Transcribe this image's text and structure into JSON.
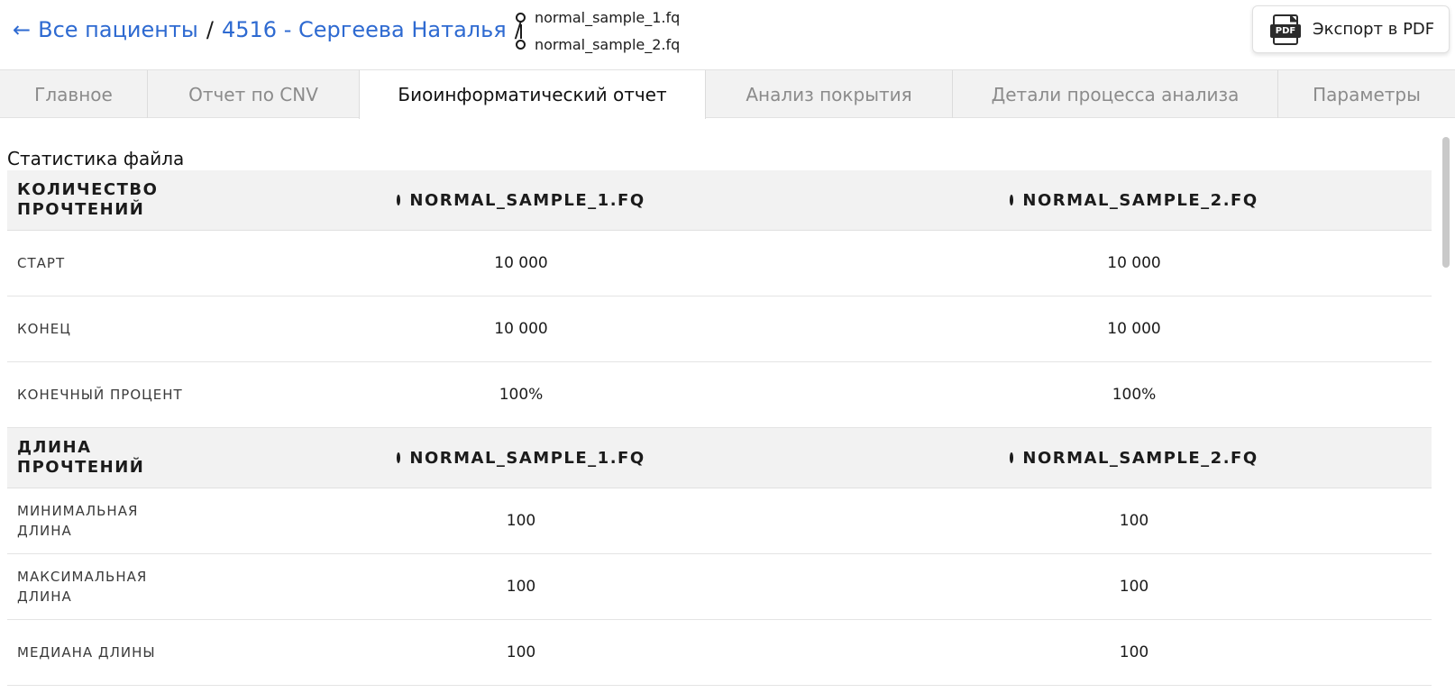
{
  "breadcrumb": {
    "back_arrow": "←",
    "all_patients": "Все пациенты",
    "separator": "/",
    "patient": "4516 - Сергеева Наталья"
  },
  "files": [
    "normal_sample_1.fq",
    "normal_sample_2.fq"
  ],
  "export": {
    "label": "Экспорт в PDF",
    "icon_text": "PDF",
    "icon": "pdf-icon"
  },
  "tabs": [
    {
      "label": "Главное"
    },
    {
      "label": "Отчет по CNV"
    },
    {
      "label": "Биоинформатический отчет",
      "active": true
    },
    {
      "label": "Анализ покрытия"
    },
    {
      "label": "Детали процесса анализа"
    },
    {
      "label": "Параметры"
    }
  ],
  "section_title": "Статистика файла",
  "table": {
    "reads_count_header": "КОЛИЧЕСТВО ПРОЧТЕНИЙ",
    "read_length_header": "ДЛИНА ПРОЧТЕНИЙ",
    "sample_1": "NORMAL_SAMPLE_1.FQ",
    "sample_2": "NORMAL_SAMPLE_2.FQ",
    "rows": [
      {
        "label": "СТАРТ",
        "v1": "10 000",
        "v2": "10 000"
      },
      {
        "label": "КОНЕЦ",
        "v1": "10 000",
        "v2": "10 000"
      },
      {
        "label": "КОНЕЧНЫЙ ПРОЦЕНТ",
        "v1": "100%",
        "v2": "100%"
      },
      {
        "label": "МИНИМАЛЬНАЯ ДЛИНА",
        "v1": "100",
        "v2": "100"
      },
      {
        "label": "МАКСИМАЛЬНАЯ ДЛИНА",
        "v1": "100",
        "v2": "100"
      },
      {
        "label": "МЕДИАНА ДЛИНЫ",
        "v1": "100",
        "v2": "100"
      }
    ]
  },
  "colors": {
    "link": "#2e6ad1",
    "tab_bg": "#f2f2f2",
    "header_row_bg": "#f2f2f2"
  }
}
